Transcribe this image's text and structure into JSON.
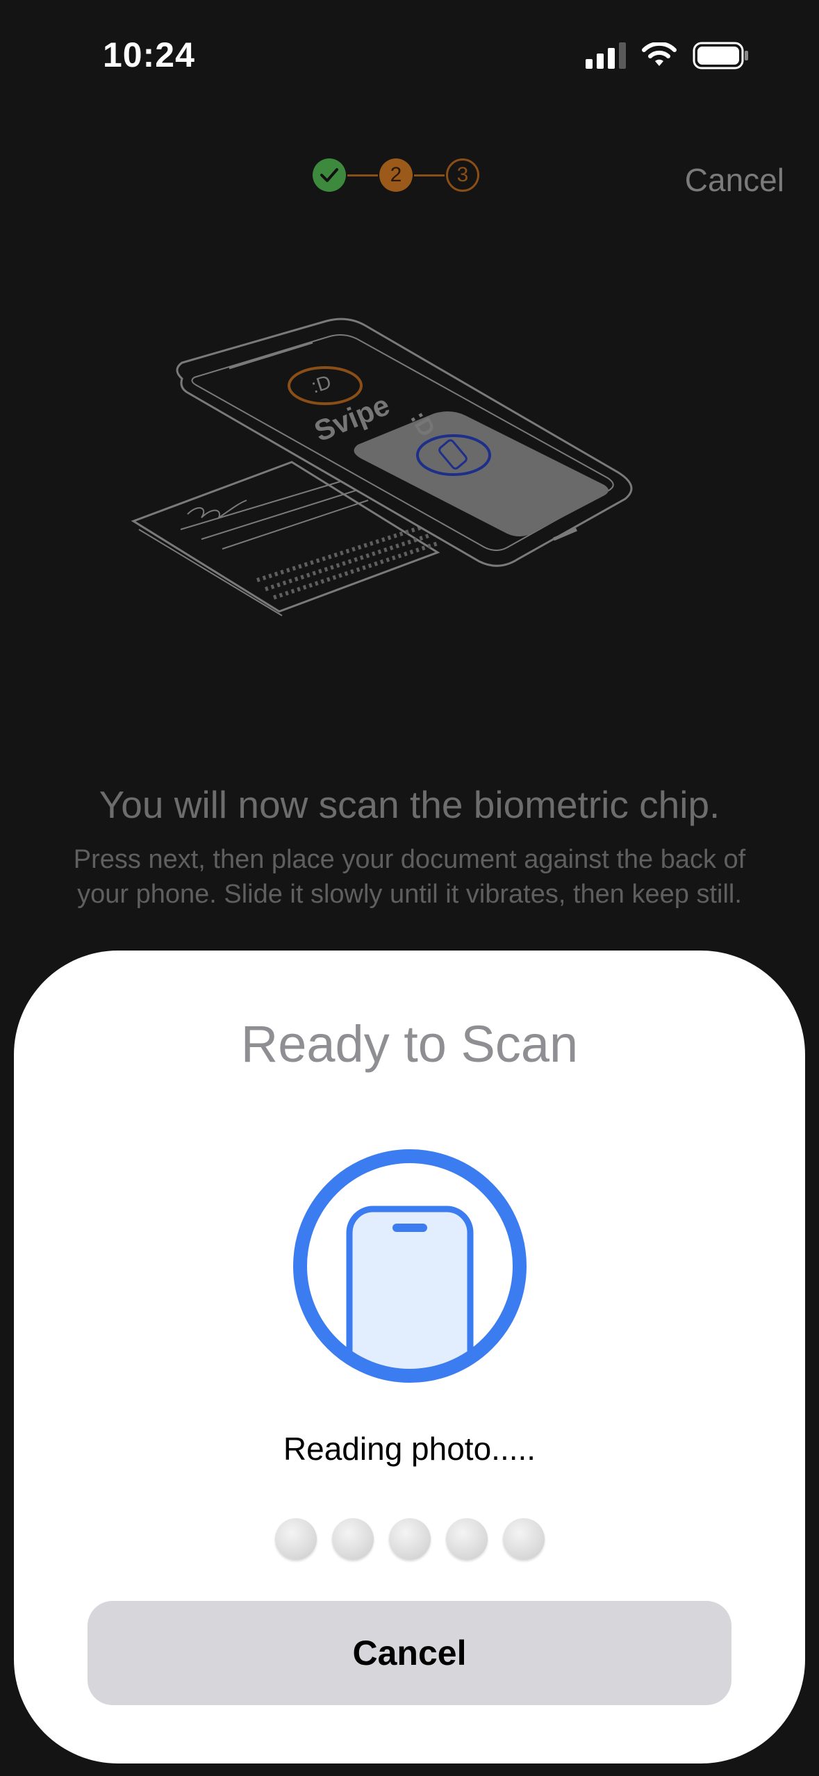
{
  "status_bar": {
    "time": "10:24"
  },
  "stepper": {
    "steps": [
      {
        "state": "done",
        "label": ""
      },
      {
        "state": "current",
        "label": "2"
      },
      {
        "state": "upcoming",
        "label": "3"
      }
    ]
  },
  "header": {
    "cancel_label": "Cancel"
  },
  "illustration": {
    "brand_text": "Svipe"
  },
  "instructions": {
    "headline": "You will now scan the biometric chip.",
    "line1": "Press next, then place your document against the back of",
    "line2": "your phone. Slide it slowly until it vibrates, then keep still."
  },
  "scan_sheet": {
    "title": "Ready to Scan",
    "status": "Reading photo.....",
    "progress_total": 5,
    "progress_filled": 0,
    "cancel_label": "Cancel"
  },
  "colors": {
    "background": "#141414",
    "step_done": "#3d8a3e",
    "step_active": "#9c5a1a",
    "nfc_blue": "#3b7cf0",
    "sheet_bg": "#ffffff",
    "cancel_button_bg": "#d6d6db"
  },
  "icons": {
    "signal": "cellular-signal-icon",
    "wifi": "wifi-icon",
    "battery": "battery-icon",
    "check": "checkmark-icon",
    "scan": "phone-nfc-icon"
  }
}
